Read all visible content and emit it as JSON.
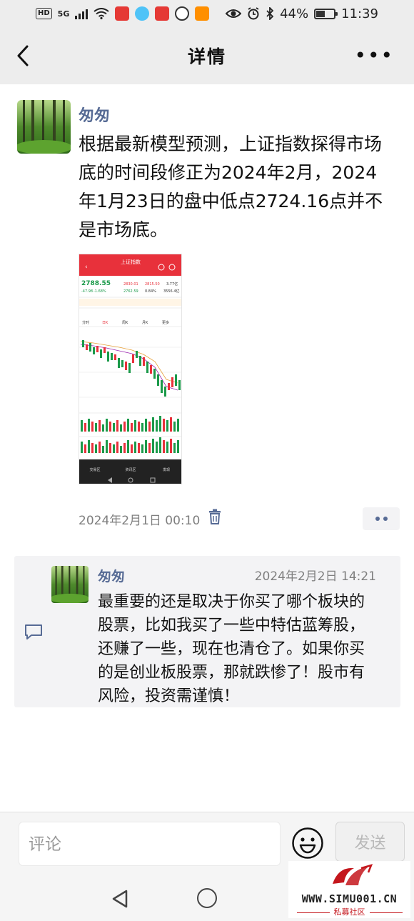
{
  "status_bar": {
    "network_hd": "HD",
    "network_gen": "5G",
    "eye_icon": "eye-icon",
    "battery": "44%",
    "time": "11:39"
  },
  "nav": {
    "title": "详情",
    "more": "•••"
  },
  "post": {
    "author": "匆匆",
    "text": "根据最新模型预测，上证指数探得市场底的时间段修正为2024年2月，2024年1月23日的盘中低点2724.16点并不是市场底。",
    "time": "2024年2月1日 00:10",
    "image": {
      "title": "上证指数",
      "price": "2788.55",
      "change": "-47.98",
      "change_pct": "-1.68%",
      "high": "2830.01",
      "low": "2762.59",
      "open": "2815.50",
      "turnover_pct": "0.84%",
      "volume": "3.77亿",
      "amount": "3556.4亿",
      "tabs": [
        "分时",
        "日K",
        "周K",
        "月K",
        "更多"
      ],
      "bottom_tabs": [
        "交易区",
        "资讯区",
        "发现"
      ]
    }
  },
  "comment": {
    "author": "匆匆",
    "time": "2024年2月2日 14:21",
    "text": "最重要的还是取决于你买了哪个板块的股票，比如我买了一些中特估蓝筹股，还赚了一些，现在也清仓了。如果你买的是创业板股票，那就跌惨了！股市有风险，投资需谨慎！"
  },
  "comment_bar": {
    "placeholder": "评论",
    "send_label": "发送"
  },
  "watermark": {
    "url": "WWW.SIMU001.CN",
    "sub": "私募社区"
  },
  "colors": {
    "link_blue": "#576b95",
    "stock_red": "#e8313b",
    "stock_green": "#1b9a4a"
  }
}
